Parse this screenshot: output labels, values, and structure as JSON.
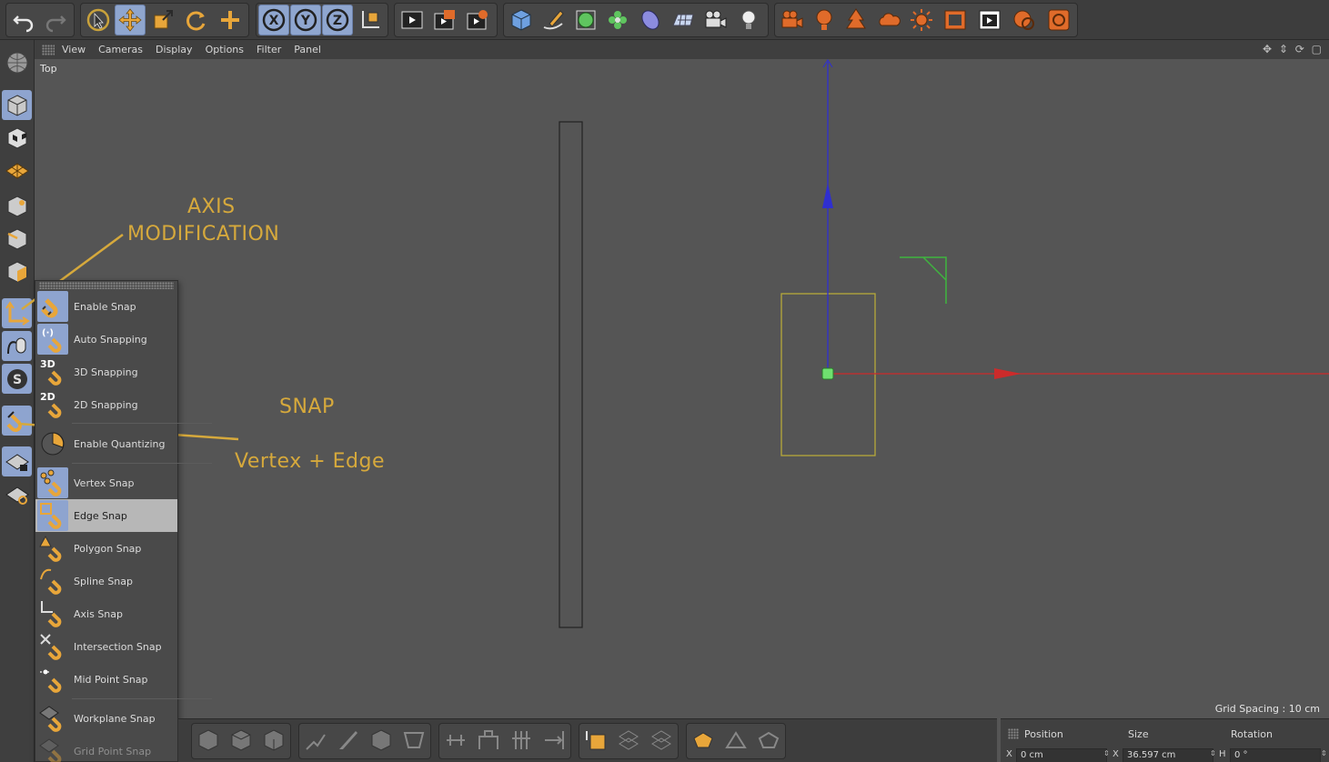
{
  "viewport": {
    "menu": [
      "View",
      "Cameras",
      "Display",
      "Options",
      "Filter",
      "Panel"
    ],
    "view_name": "Top",
    "nav_icons": "✥ ⇕ ⟳ ▢",
    "grid_spacing": "Grid Spacing : 10 cm"
  },
  "snap_menu": {
    "items": [
      {
        "label": "Enable Snap",
        "icon": "magnet-icon"
      },
      {
        "label": "Auto Snapping",
        "icon": "auto-snap-icon"
      },
      {
        "label": "3D Snapping",
        "icon": "snap-3d-icon"
      },
      {
        "label": "2D Snapping",
        "icon": "snap-2d-icon"
      },
      {
        "label": "Enable Quantizing",
        "icon": "quantize-icon"
      },
      {
        "label": "Vertex Snap",
        "icon": "vertex-snap-icon"
      },
      {
        "label": "Edge Snap",
        "icon": "edge-snap-icon",
        "highlighted": true
      },
      {
        "label": "Polygon Snap",
        "icon": "polygon-snap-icon"
      },
      {
        "label": "Spline Snap",
        "icon": "spline-snap-icon"
      },
      {
        "label": "Axis Snap",
        "icon": "axis-snap-icon"
      },
      {
        "label": "Intersection Snap",
        "icon": "intersection-snap-icon"
      },
      {
        "label": "Mid Point Snap",
        "icon": "midpoint-snap-icon"
      },
      {
        "label": "Workplane Snap",
        "icon": "workplane-snap-icon"
      },
      {
        "label": "Grid Point Snap",
        "icon": "grid-point-snap-icon",
        "disabled": true
      }
    ]
  },
  "annotations": {
    "axis_line1": "AXIS",
    "axis_line2": "MODIFICATION",
    "snap": "SNAP",
    "vertex_edge": "Vertex + Edge"
  },
  "coordinates": {
    "position_label": "Position",
    "size_label": "Size",
    "rotation_label": "Rotation",
    "position_x": "0 cm",
    "size_x": "36.597 cm",
    "rotation_h": "0 °",
    "axis_x": "X",
    "axis_h": "H"
  },
  "colors": {
    "annotation": "#d6a93c",
    "active_tool": "#8ea4cf",
    "axis_y": "#2f2fd0",
    "axis_x": "#cc2b2b",
    "selection": "#b7a93a",
    "gizmo_green": "#3fb53f"
  }
}
